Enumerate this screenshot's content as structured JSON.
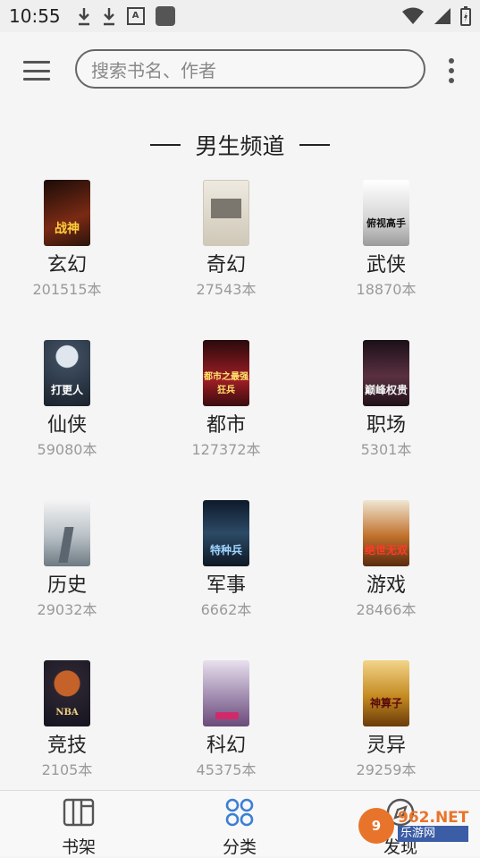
{
  "status": {
    "time": "10:55"
  },
  "search": {
    "placeholder": "搜索书名、作者"
  },
  "section": {
    "title": "男生频道"
  },
  "categories": [
    {
      "name": "玄幻",
      "count": "201515本",
      "cover_text": "战神",
      "cover_color": "#5a1e14"
    },
    {
      "name": "奇幻",
      "count": "27543本",
      "cover_text": "",
      "cover_color": "#ddd8cc"
    },
    {
      "name": "武侠",
      "count": "18870本",
      "cover_text": "俯视高手",
      "cover_color": "#e4e4e4"
    },
    {
      "name": "仙侠",
      "count": "59080本",
      "cover_text": "打更人",
      "cover_color": "#2c3a4a"
    },
    {
      "name": "都市",
      "count": "127372本",
      "cover_text": "都市之最强狂兵",
      "cover_color": "#7a1a20"
    },
    {
      "name": "职场",
      "count": "5301本",
      "cover_text": "巅峰权贵",
      "cover_color": "#3a2230"
    },
    {
      "name": "历史",
      "count": "29032本",
      "cover_text": "",
      "cover_color": "#c7ccd0"
    },
    {
      "name": "军事",
      "count": "6662本",
      "cover_text": "特种兵",
      "cover_color": "#1e3040"
    },
    {
      "name": "游戏",
      "count": "28466本",
      "cover_text": "绝世无双",
      "cover_color": "#8a5a24"
    },
    {
      "name": "竞技",
      "count": "2105本",
      "cover_text": "NBA",
      "cover_color": "#222a3a"
    },
    {
      "name": "科幻",
      "count": "45375本",
      "cover_text": "",
      "cover_color": "#b9a9c4"
    },
    {
      "name": "灵异",
      "count": "29259本",
      "cover_text": "神算子",
      "cover_color": "#b07a18"
    }
  ],
  "bottom_nav": {
    "shelf": "书架",
    "category": "分类",
    "discover": "发现"
  },
  "watermark": {
    "brand": "962.NET",
    "brand_cn": "乐游网"
  },
  "colors": {
    "accent": "#3b7fd4",
    "text": "#222222",
    "muted": "#9a9a9a"
  }
}
